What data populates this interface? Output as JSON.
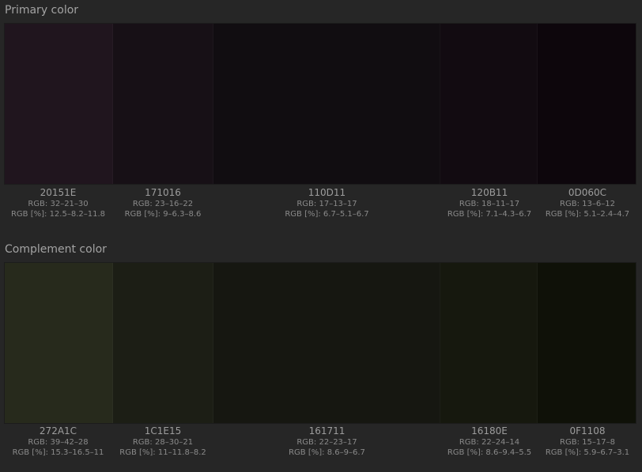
{
  "sections": [
    {
      "title": "Primary color",
      "swatches": [
        {
          "hex": "20151E",
          "rgb": "RGB: 32–21–30",
          "pct": "RGB [%]: 12.5–8.2–11.8",
          "color": "#20151E"
        },
        {
          "hex": "171016",
          "rgb": "RGB: 23–16–22",
          "pct": "RGB [%]: 9–6.3–8.6",
          "color": "#171016"
        },
        {
          "hex": "110D11",
          "rgb": "RGB: 17–13–17",
          "pct": "RGB [%]: 6.7–5.1–6.7",
          "color": "#110D11"
        },
        {
          "hex": "120B11",
          "rgb": "RGB: 18–11–17",
          "pct": "RGB [%]: 7.1–4.3–6.7",
          "color": "#120B11"
        },
        {
          "hex": "0D060C",
          "rgb": "RGB: 13–6–12",
          "pct": "RGB [%]: 5.1–2.4–4.7",
          "color": "#0D060C"
        }
      ]
    },
    {
      "title": "Complement color",
      "swatches": [
        {
          "hex": "272A1C",
          "rgb": "RGB: 39–42–28",
          "pct": "RGB [%]: 15.3–16.5–11",
          "color": "#272A1C"
        },
        {
          "hex": "1C1E15",
          "rgb": "RGB: 28–30–21",
          "pct": "RGB [%]: 11–11.8–8.2",
          "color": "#1C1E15"
        },
        {
          "hex": "161711",
          "rgb": "RGB: 22–23–17",
          "pct": "RGB [%]: 8.6–9–6.7",
          "color": "#161711"
        },
        {
          "hex": "16180E",
          "rgb": "RGB: 22–24–14",
          "pct": "RGB [%]: 8.6–9.4–5.5",
          "color": "#16180E"
        },
        {
          "hex": "0F1108",
          "rgb": "RGB: 15–17–8",
          "pct": "RGB [%]: 5.9–6.7–3.1",
          "color": "#0F1108"
        }
      ]
    }
  ]
}
